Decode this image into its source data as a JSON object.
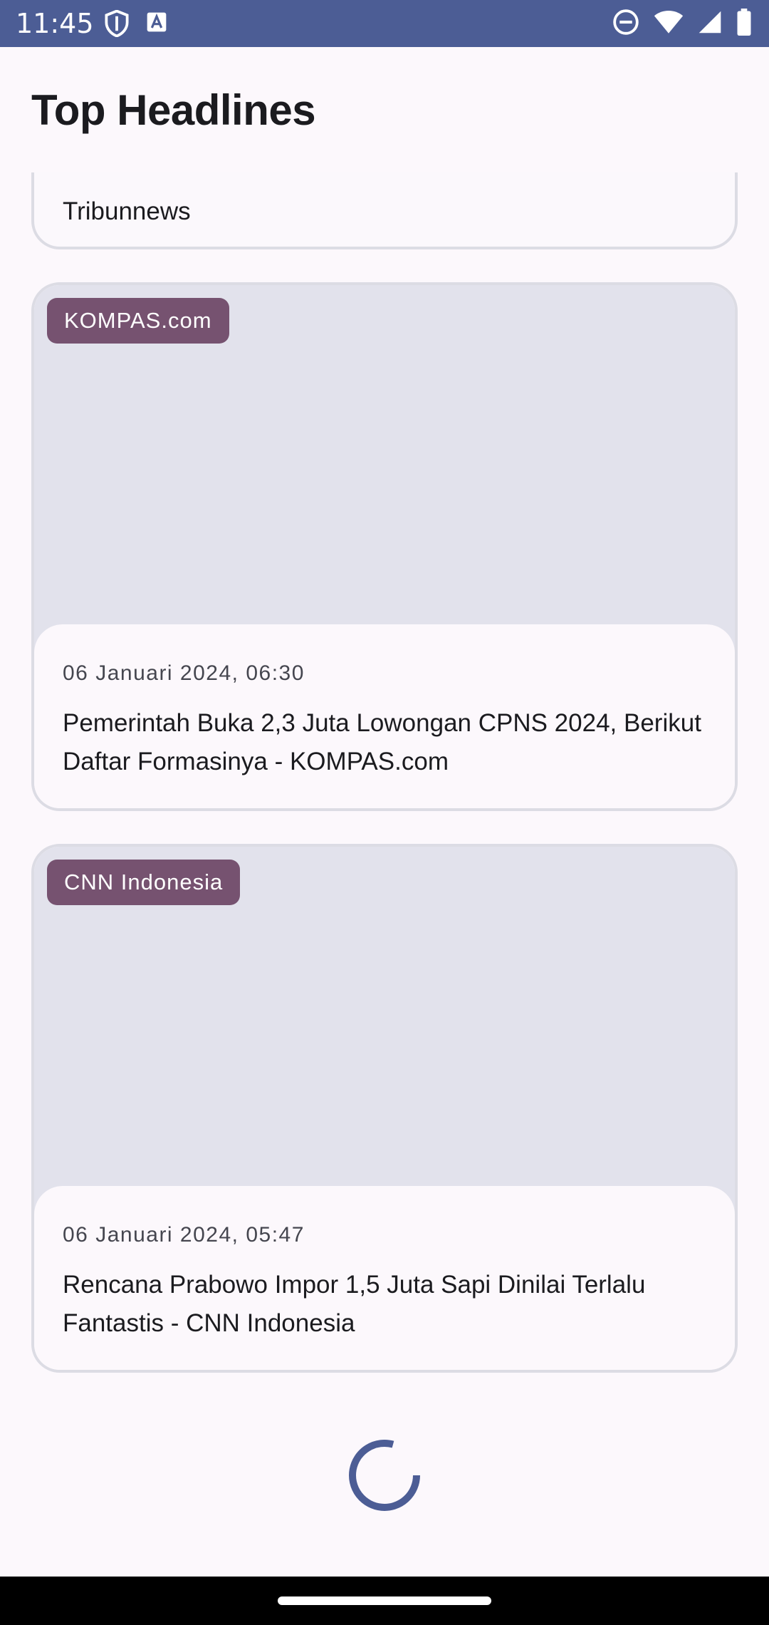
{
  "status_bar": {
    "time": "11:45",
    "left_icons": [
      "shield-icon",
      "text-box-icon"
    ],
    "right_icons": [
      "do-not-disturb-icon",
      "wifi-icon",
      "signal-icon",
      "battery-icon"
    ]
  },
  "app_bar": {
    "title": "Top Headlines"
  },
  "articles": [
    {
      "source": "",
      "date": "",
      "title": "Tribunnews"
    },
    {
      "source": "KOMPAS.com",
      "date": "06 Januari 2024, 06:30",
      "title": "Pemerintah Buka 2,3 Juta Lowongan CPNS 2024, Berikut Daftar Formasinya - KOMPAS.com"
    },
    {
      "source": "CNN Indonesia",
      "date": "06 Januari 2024, 05:47",
      "title": "Rencana Prabowo Impor 1,5 Juta Sapi Dinilai Terlalu Fantastis - CNN Indonesia"
    }
  ],
  "colors": {
    "status_bar": "#4c5d95",
    "chip": "#765270",
    "media_placeholder": "#e2e2ec",
    "spinner": "#4c5d95"
  }
}
